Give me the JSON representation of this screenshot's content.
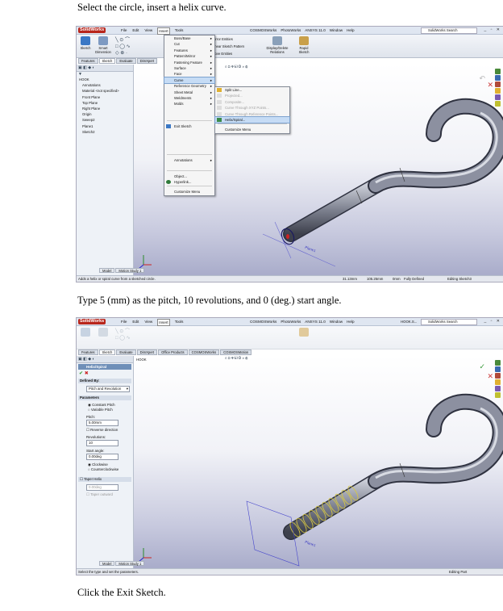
{
  "captions": {
    "step1": "Select the circle, insert a helix curve.",
    "step2": "Type 5 (mm) as the pitch, 10 revolutions, and 0 (deg.) start angle.",
    "step3": "Click the Exit Sketch."
  },
  "app": {
    "brand": "SolidWorks",
    "menus": [
      "File",
      "Edit",
      "View",
      "Insert",
      "Tools",
      "COSMOSWorks",
      "PhotoWorks",
      "ANSYS 11.0",
      "Window",
      "Help"
    ],
    "search_placeholder": "SolidWorks Search",
    "doc_name": "HOOK.S..."
  },
  "shot1": {
    "ribbon": {
      "sketch": "Sketch",
      "smart_dimension": "Smart Dimension",
      "mirror_entities": "Mirror Entities",
      "linear_sketch_pattern": "Linear Sketch Pattern",
      "move_entities": "Move Entities",
      "display_delete_relations": "Display/Delete Relations",
      "rapid_sketch": "Rapid Sketch"
    },
    "tabs": [
      "Features",
      "Sketch",
      "Evaluate",
      "DimXpert"
    ],
    "active_tab": "Sketch",
    "tree": [
      "HOOK",
      "Annotations",
      "Material <not specified>",
      "Front Plane",
      "Top Plane",
      "Right Plane",
      "Origin",
      "Sweep2",
      "Plane1",
      "Sketch2"
    ],
    "insert_menu": [
      "Boss/Base",
      "Cut",
      "Features",
      "Pattern/Mirror",
      "Fastening Feature",
      "Surface",
      "Face",
      "Curve",
      "Reference Geometry",
      "Sheet Metal",
      "Weldments",
      "Molds",
      "Exit Sketch",
      "Annotations",
      "Object...",
      "Hyperlink...",
      "Customize Menu"
    ],
    "curve_menu": [
      "Split Line...",
      "Projected...",
      "Composite...",
      "Curve Through XYZ Points...",
      "Curve Through Reference Points...",
      "Helix/Spiral...",
      "Customize Menu"
    ],
    "highlighted": "Helix/Spiral...",
    "status": {
      "hint": "Adds a helix or spiral curve from a sketched circle.",
      "x": "31.13mm",
      "y": "105.25mm",
      "z": "0mm",
      "state": "Fully Defined",
      "editing": "Editing Sketch3"
    },
    "bottom_tabs": [
      "Model",
      "Motion Study 1"
    ],
    "plane_label": "Plane1"
  },
  "shot2": {
    "tabs": [
      "Features",
      "Sketch",
      "Evaluate",
      "DimXpert",
      "Office Products",
      "COSMOSWorks",
      "COSMOSMotion"
    ],
    "active_tab": "Sketch",
    "doc_label": "HOOK",
    "pm_title": "Helix/Spiral",
    "defined_by_label": "Defined By:",
    "defined_by_value": "Pitch and Revolution",
    "parameters_label": "Parameters",
    "constant_pitch": "Constant Pitch",
    "variable_pitch": "Variable Pitch",
    "pitch_label": "Pitch:",
    "pitch_value": "5.00mm",
    "reverse_direction": "Reverse direction",
    "revolutions_label": "Revolutions:",
    "revolutions_value": "10",
    "start_angle_label": "Start angle:",
    "start_angle_value": "0.00deg",
    "clockwise": "Clockwise",
    "counterclockwise": "Counterclockwise",
    "taper_helix": "Taper Helix",
    "taper_angle": "0.00deg",
    "taper_outward": "Taper outward",
    "status": {
      "hint": "Select the type and set the parameters.",
      "editing": "Editing Part"
    },
    "bottom_tabs": [
      "Model",
      "Motion Study 1"
    ],
    "plane_label": "Plane1"
  }
}
